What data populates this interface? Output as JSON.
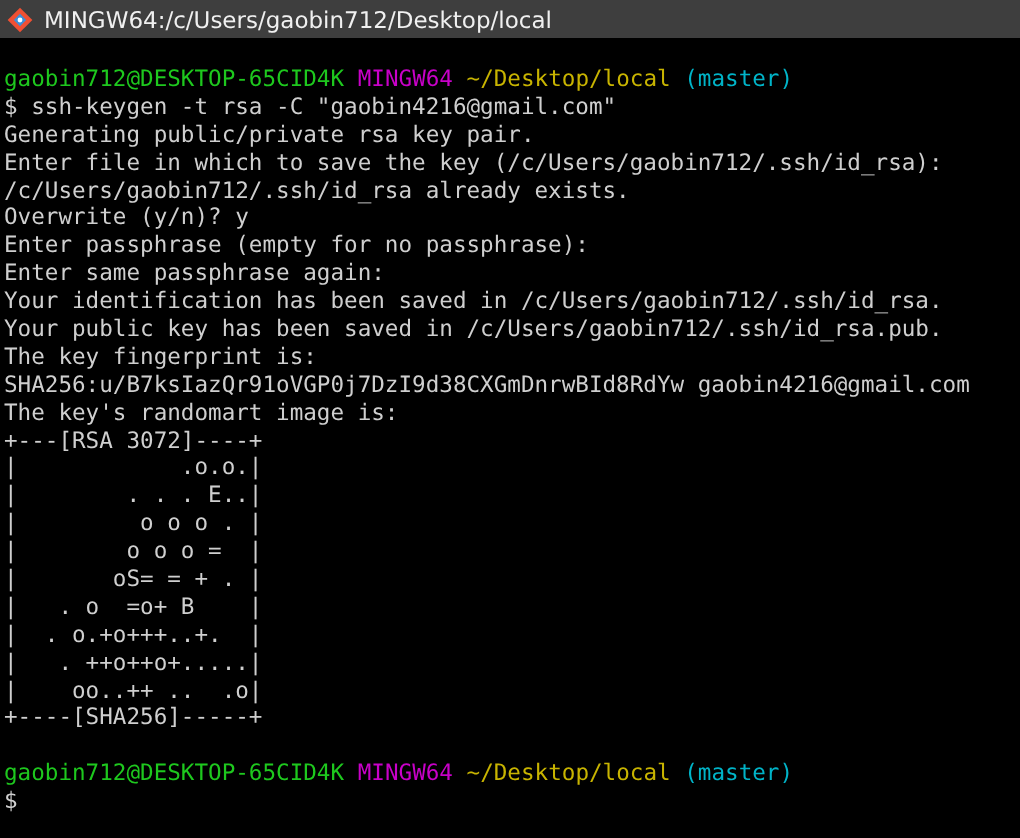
{
  "window": {
    "title": "MINGW64:/c/Users/gaobin712/Desktop/local"
  },
  "lines": [
    {
      "kind": "prompt",
      "user_host": "gaobin712@DESKTOP-65CID4K",
      "shell": "MINGW64",
      "path": "~/Desktop/local",
      "branch": "(master)"
    },
    {
      "kind": "text",
      "text": "$ ssh-keygen -t rsa -C \"gaobin4216@gmail.com\""
    },
    {
      "kind": "text",
      "text": "Generating public/private rsa key pair."
    },
    {
      "kind": "text",
      "text": "Enter file in which to save the key (/c/Users/gaobin712/.ssh/id_rsa):"
    },
    {
      "kind": "text",
      "text": "/c/Users/gaobin712/.ssh/id_rsa already exists."
    },
    {
      "kind": "text",
      "text": "Overwrite (y/n)? y"
    },
    {
      "kind": "text",
      "text": "Enter passphrase (empty for no passphrase):"
    },
    {
      "kind": "text",
      "text": "Enter same passphrase again:"
    },
    {
      "kind": "text",
      "text": "Your identification has been saved in /c/Users/gaobin712/.ssh/id_rsa."
    },
    {
      "kind": "text",
      "text": "Your public key has been saved in /c/Users/gaobin712/.ssh/id_rsa.pub."
    },
    {
      "kind": "text",
      "text": "The key fingerprint is:"
    },
    {
      "kind": "text",
      "text": "SHA256:u/B7ksIazQr91oVGP0j7DzI9d38CXGmDnrwBId8RdYw gaobin4216@gmail.com"
    },
    {
      "kind": "text",
      "text": "The key's randomart image is:"
    },
    {
      "kind": "text",
      "text": "+---[RSA 3072]----+"
    },
    {
      "kind": "text",
      "text": "|            .o.o.|"
    },
    {
      "kind": "text",
      "text": "|        . . . E..|"
    },
    {
      "kind": "text",
      "text": "|         o o o . |"
    },
    {
      "kind": "text",
      "text": "|        o o o =  |"
    },
    {
      "kind": "text",
      "text": "|       oS= = + . |"
    },
    {
      "kind": "text",
      "text": "|   . o  =o+ B    |"
    },
    {
      "kind": "text",
      "text": "|  . o.+o+++..+.  |"
    },
    {
      "kind": "text",
      "text": "|   . ++o++o+.....|"
    },
    {
      "kind": "text",
      "text": "|    oo..++ ..  .o|"
    },
    {
      "kind": "text",
      "text": "+----[SHA256]-----+"
    },
    {
      "kind": "blank"
    },
    {
      "kind": "prompt",
      "user_host": "gaobin712@DESKTOP-65CID4K",
      "shell": "MINGW64",
      "path": "~/Desktop/local",
      "branch": "(master)"
    },
    {
      "kind": "text",
      "text": "$"
    }
  ]
}
